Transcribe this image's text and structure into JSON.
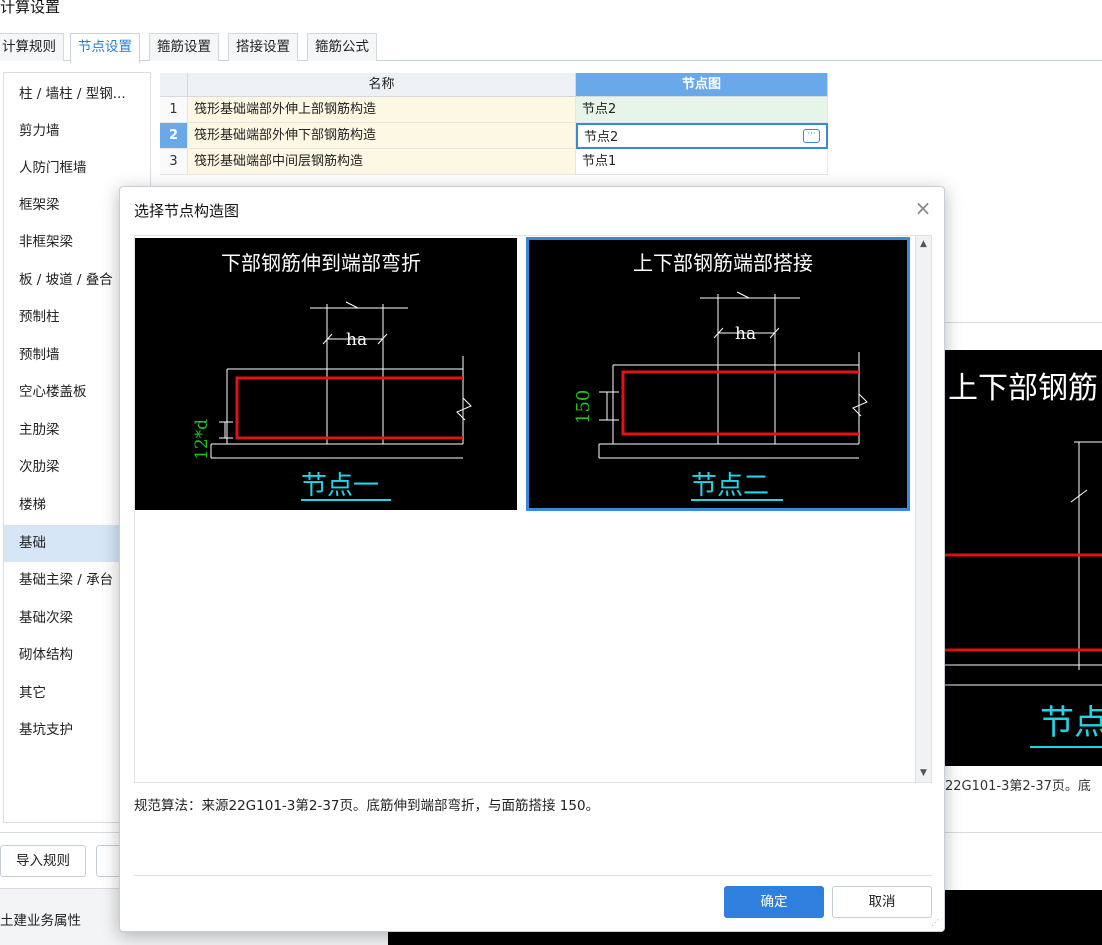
{
  "window": {
    "title": "计算设置"
  },
  "tabs": [
    {
      "label": "计算规则"
    },
    {
      "label": "节点设置"
    },
    {
      "label": "箍筋设置"
    },
    {
      "label": "搭接设置"
    },
    {
      "label": "箍筋公式"
    }
  ],
  "sidebar": {
    "items": [
      {
        "label": "柱 / 墙柱 / 型钢..."
      },
      {
        "label": "剪力墙"
      },
      {
        "label": "人防门框墙"
      },
      {
        "label": "框架梁"
      },
      {
        "label": "非框架梁"
      },
      {
        "label": "板 / 坡道 / 叠合"
      },
      {
        "label": "预制柱"
      },
      {
        "label": "预制墙"
      },
      {
        "label": "空心楼盖板"
      },
      {
        "label": "主肋梁"
      },
      {
        "label": "次肋梁"
      },
      {
        "label": "楼梯"
      },
      {
        "label": "基础"
      },
      {
        "label": "基础主梁 / 承台"
      },
      {
        "label": "基础次梁"
      },
      {
        "label": "砌体结构"
      },
      {
        "label": "其它"
      },
      {
        "label": "基坑支护"
      }
    ],
    "selected_index": 12
  },
  "table": {
    "headers": {
      "name": "名称",
      "diagram": "节点图"
    },
    "rows": [
      {
        "num": "1",
        "name": "筏形基础端部外伸上部钢筋构造",
        "value": "节点2"
      },
      {
        "num": "2",
        "name": "筏形基础端部外伸下部钢筋构造",
        "value": "节点2"
      },
      {
        "num": "3",
        "name": "筏形基础端部中间层钢筋构造",
        "value": "节点1"
      }
    ],
    "edit_button": "···"
  },
  "right_preview": {
    "title_fragment": "上下部钢筋",
    "node_fragment": "节点",
    "desc_fragment": "22G101-3第2-37页。底"
  },
  "bottom": {
    "import_button": "导入规则",
    "property_rows": [
      "土建业务属性"
    ]
  },
  "dialog": {
    "title": "选择节点构造图",
    "close": "×",
    "options": [
      {
        "heading": "下部钢筋伸到端部弯折",
        "dimension": "ha",
        "side_label": "12*d",
        "caption": "节点一"
      },
      {
        "heading": "上下部钢筋端部搭接",
        "dimension": "ha",
        "side_label": "150",
        "caption": "节点二"
      }
    ],
    "selected_option": 1,
    "description": "规范算法：来源22G101-3第2-37页。底筋伸到端部弯折，与面筋搭接 150。",
    "ok_button": "确定",
    "cancel_button": "取消"
  },
  "colors": {
    "accent": "#2f7fde",
    "rebar": "#e01414",
    "caption": "#22d3e6",
    "dimension_label": "#1fc41f"
  }
}
